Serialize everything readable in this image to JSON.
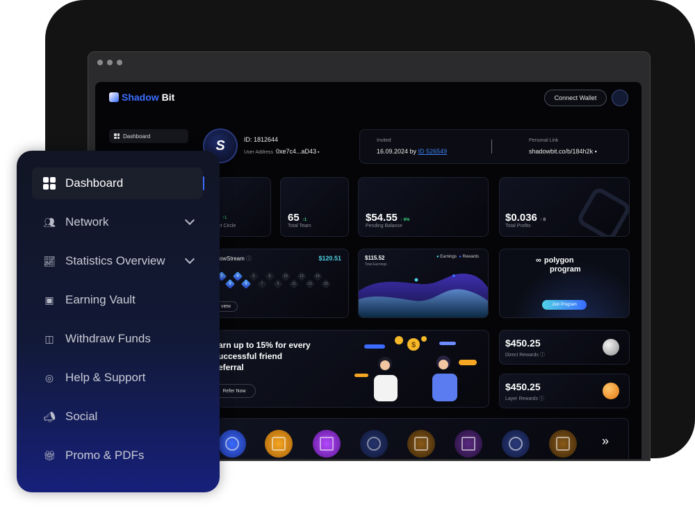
{
  "app": {
    "brand_part1": "Shadow",
    "brand_part2": "Bit",
    "connect_wallet": "Connect Wallet"
  },
  "mini_sidebar": {
    "dashboard": "Dashboard"
  },
  "user": {
    "id_label": "ID: 1812644",
    "address_label": "User Address",
    "address": "0xe7c4...aD43"
  },
  "invited": {
    "label": "Invited",
    "date": "16.09.2024 by",
    "by_id": "ID 526549"
  },
  "personal_link": {
    "label": "Personal Link",
    "value": "shadowbit.co/b/184h2k"
  },
  "stats": {
    "direct_circle": {
      "change": "↑1",
      "label": "ct Circle"
    },
    "total_team": {
      "value": "65",
      "change": "↑1",
      "label": "Total Team"
    },
    "pending_balance": {
      "value": "$54.55",
      "change": "↑ 6%",
      "label": "Pending Balance"
    },
    "total_profits": {
      "value": "$0.036",
      "change": "↑ 0",
      "label": "Total Profits"
    }
  },
  "flowstream": {
    "title": "lowStream",
    "amount": "$120.51",
    "button": "view",
    "levels": [
      "2",
      "3",
      "4",
      "5",
      "6",
      "7",
      "8",
      "9",
      "10",
      "11",
      "12",
      "13",
      "14",
      "15"
    ]
  },
  "earnings_chart": {
    "value": "$115.52",
    "label": "Total Earnings",
    "legend_earnings": "Earnings",
    "legend_rewards": "Rewards"
  },
  "polygon": {
    "title_line1": "polygon",
    "title_line2": "program",
    "button": "Join Program"
  },
  "referral": {
    "line1": "arn up to 15% for every",
    "line2": "uccessful friend",
    "line3": "eferral",
    "button": "Refer Now"
  },
  "rewards": {
    "direct": {
      "value": "$450.25",
      "label": "Direct Rewards"
    },
    "layer": {
      "value": "$450.25",
      "label": "Layer Rewards"
    }
  },
  "main_sidebar": {
    "items": [
      {
        "label": "Dashboard",
        "icon": "grid-icon"
      },
      {
        "label": "Network",
        "icon": "users-icon"
      },
      {
        "label": "Statistics Overview",
        "icon": "chart-icon"
      },
      {
        "label": "Earning Vault",
        "icon": "vault-icon"
      },
      {
        "label": "Withdraw Funds",
        "icon": "wallet-icon"
      },
      {
        "label": "Help & Support",
        "icon": "support-icon"
      },
      {
        "label": "Social",
        "icon": "megaphone-icon"
      },
      {
        "label": "Promo & PDFs",
        "icon": "gift-icon"
      }
    ]
  },
  "colors": {
    "accent": "#3b6cff",
    "positive": "#3ddc84",
    "sidebar_bottom": "#16207a",
    "teal": "#4fd1e6"
  }
}
